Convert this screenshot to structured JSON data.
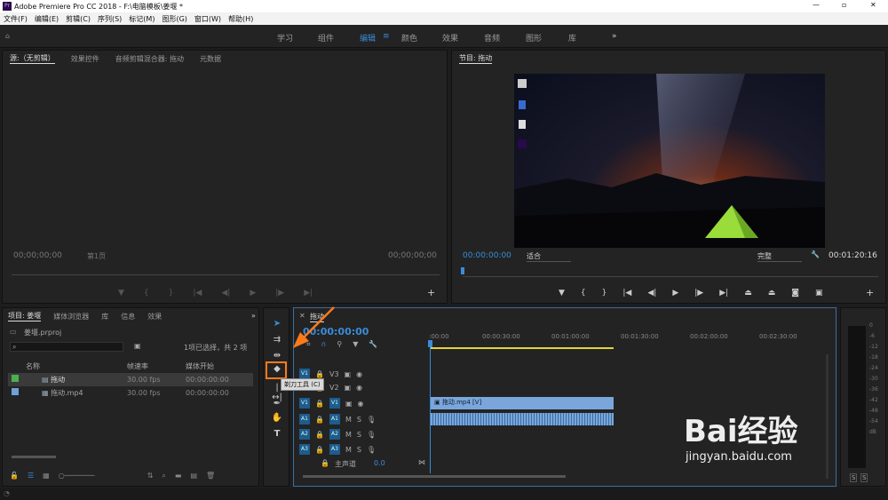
{
  "window": {
    "title": "Adobe Premiere Pro CC 2018 - F:\\电脑模板\\姜堰 *"
  },
  "menu": [
    "文件(F)",
    "编辑(E)",
    "剪辑(C)",
    "序列(S)",
    "标记(M)",
    "图形(G)",
    "窗口(W)",
    "帮助(H)"
  ],
  "workspaces": [
    "学习",
    "组件",
    "编辑",
    "颜色",
    "效果",
    "音频",
    "图形",
    "库"
  ],
  "active_workspace": "编辑",
  "source_panel": {
    "tabs": [
      "源:（无剪辑）",
      "效果控件",
      "音频剪辑混合器: 拖动",
      "元数据"
    ],
    "timecode_left": "00;00;00;00",
    "timecode_right": "00;00;00;00",
    "page": "第1页"
  },
  "program_panel": {
    "tab": "节目: 拖动",
    "timecode": "00:00:00:00",
    "fit": "适合",
    "quality": "完整",
    "duration": "00:01:20:16"
  },
  "project_panel": {
    "tabs": [
      "项目: 姜堰",
      "媒体浏览器",
      "库",
      "信息",
      "效果"
    ],
    "file": "姜堰.prproj",
    "selection": "1项已选择，共 2 项",
    "columns": [
      "名称",
      "帧速率",
      "媒体开始"
    ],
    "rows": [
      {
        "name": "拖动",
        "fps": "30.00 fps",
        "start": "00:00:00:00",
        "color": "#4caf50"
      },
      {
        "name": "拖动.mp4",
        "fps": "30.00 fps",
        "start": "00:00:00:00",
        "color": "#6fa0d8"
      }
    ]
  },
  "timeline": {
    "tab": "拖动",
    "timecode": "00:00:00:00",
    "ruler": [
      ":00:00",
      "00:00:30:00",
      "00:01:00:00",
      "00:01:30:00",
      "00:02:00:00",
      "00:02:30:00"
    ],
    "video_tracks": [
      "V3",
      "V2",
      "V1"
    ],
    "audio_tracks": [
      "A1",
      "A2",
      "A3"
    ],
    "master": "主声道",
    "master_value": "0.0",
    "clip_label": "拖动.mp4 [V]",
    "tooltip": "剃刀工具 (C)"
  },
  "meter_scale": [
    "0",
    "-6",
    "-12",
    "-18",
    "-24",
    "-30",
    "-36",
    "-42",
    "-48",
    "-54",
    "dB"
  ],
  "watermark": {
    "brand": "Bai经验",
    "url": "jingyan.baidu.com"
  },
  "colors": {
    "accent": "#3a8cd8",
    "highlight": "#ff7a1a"
  }
}
